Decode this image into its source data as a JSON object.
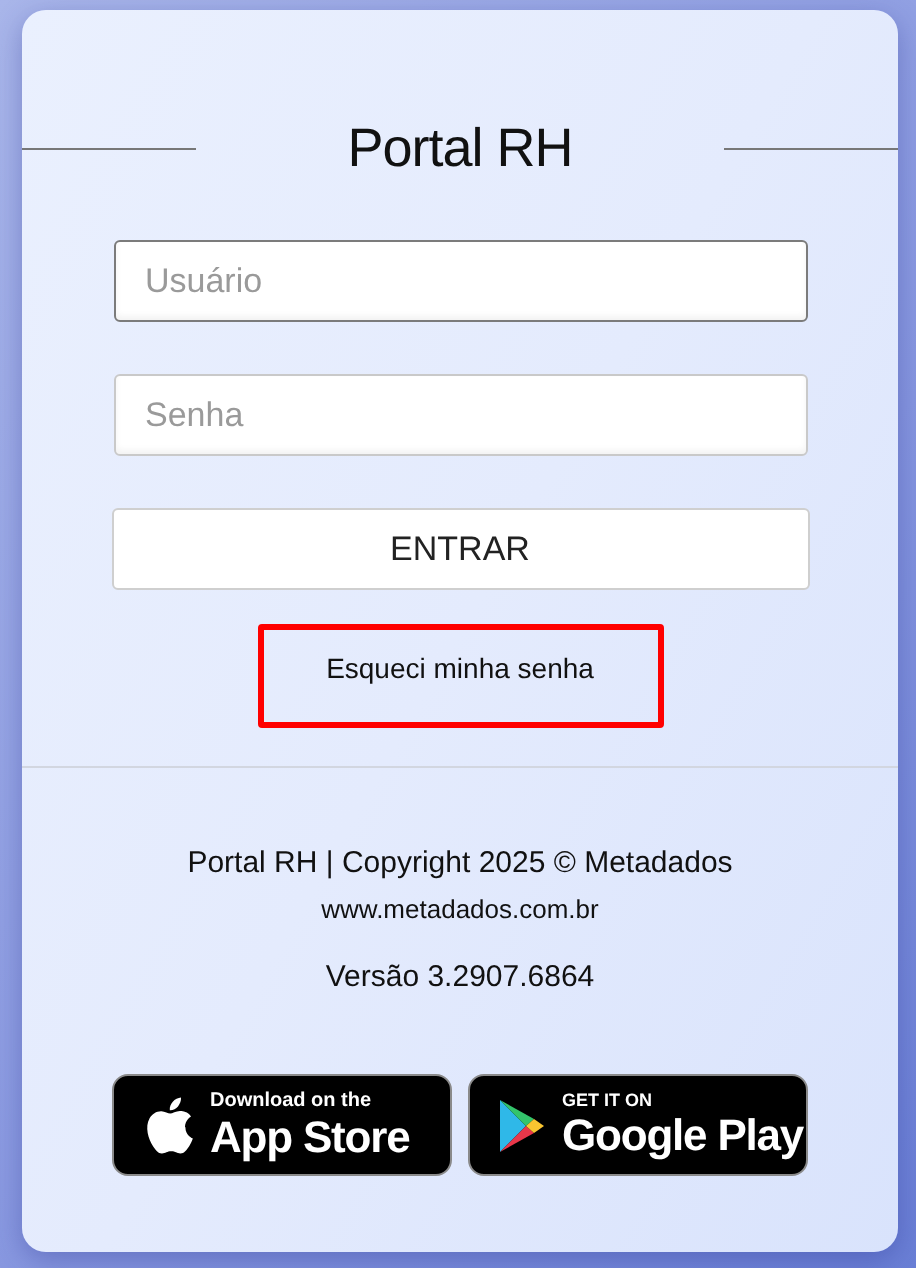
{
  "title": "Portal RH",
  "fields": [
    {
      "placeholder": "Usuário",
      "focused": true
    },
    {
      "placeholder": "Senha",
      "focused": false
    }
  ],
  "submit_button": "ENTRAR",
  "forgot_link": {
    "label": "Esqueci minha senha",
    "highlighted": true
  },
  "footer": {
    "copyright": "Portal RH | Copyright 2025 © Metadados",
    "website": "www.metadados.com.br",
    "version": "Versão 3.2907.6864"
  },
  "store_badges": [
    {
      "kind": "apple",
      "small": "Download on the",
      "big": "App Store"
    },
    {
      "kind": "google",
      "small": "GET IT ON",
      "big": "Google Play"
    }
  ]
}
